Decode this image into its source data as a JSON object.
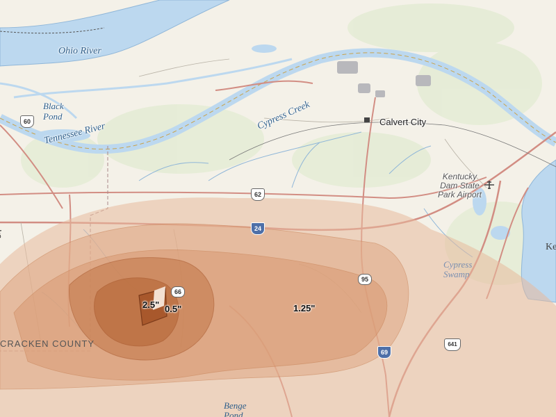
{
  "map": {
    "water_labels": {
      "ohio_river": "Ohio River",
      "tennessee_river": "Tennessee River",
      "cypress_creek": "Cypress Creek",
      "black_pond": "Black\nPond",
      "cypress_swamp": "Cypress\nSwamp",
      "benge_pond": "Benge\nPond",
      "ky_lake_partial": "Ke"
    },
    "places": {
      "calvert_city": "Calvert City",
      "airport": "Kentucky\nDam State\nPark Airport",
      "county": "CRACKEN COUNTY",
      "left_edge_partial": "ks"
    },
    "shields": {
      "us60": "60",
      "us62": "62",
      "i24": "24",
      "ky66": "66",
      "ky95": "95",
      "i69": "69",
      "us641": "641"
    },
    "contours": {
      "peak": "2.5\"",
      "inner": "0.5\"",
      "outer": "1.25\""
    },
    "colors": {
      "water": "#bcd8ef",
      "plume_outer": "#e7b99c",
      "plume_mid": "#d99a72",
      "plume_inner": "#c47a4c",
      "plume_core": "#a8582c"
    },
    "icons": [
      "airport-icon",
      "building-icon"
    ]
  }
}
